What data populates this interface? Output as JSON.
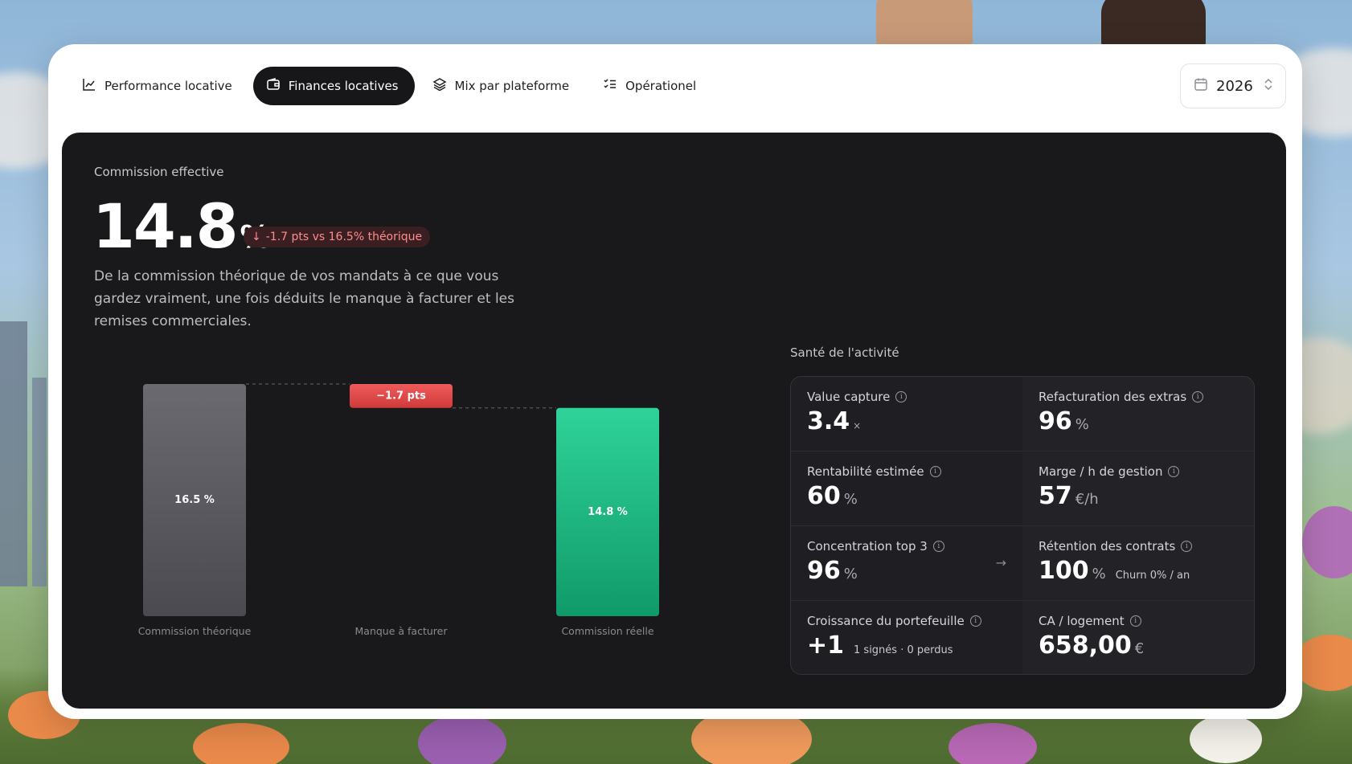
{
  "tabs": [
    {
      "label": "Performance locative",
      "icon": "chart-line-icon",
      "active": false
    },
    {
      "label": "Finances locatives",
      "icon": "wallet-icon",
      "active": true
    },
    {
      "label": "Mix par plateforme",
      "icon": "layers-icon",
      "active": false
    },
    {
      "label": "Opérationel",
      "icon": "checklist-icon",
      "active": false
    }
  ],
  "year_selector": {
    "value": "2026",
    "icon": "calendar-icon"
  },
  "commission": {
    "label": "Commission effective",
    "value": "14.8",
    "unit": "%",
    "delta": "-1.7 pts vs 16.5% théorique",
    "description": "De la commission théorique de vos mandats à ce que vous gardez vraiment, une fois déduits le manque à facturer et les remises commerciales."
  },
  "chart_data": {
    "type": "bar",
    "subtype": "waterfall",
    "categories": [
      "Commission théorique",
      "Manque à facturer",
      "Commission réelle"
    ],
    "values": [
      16.5,
      -1.7,
      14.8
    ],
    "data_labels": [
      "16.5 %",
      "−1.7 pts",
      "14.8 %"
    ],
    "colors": [
      "#5a5a60",
      "#e24b4b",
      "#22c58b"
    ],
    "ylim": [
      0,
      16.5
    ]
  },
  "health": {
    "title": "Santé de l'activité",
    "metrics": [
      {
        "label": "Value capture",
        "value": "3.4",
        "unit": "×",
        "sub": ""
      },
      {
        "label": "Refacturation des extras",
        "value": "96",
        "unit": "%",
        "sub": ""
      },
      {
        "label": "Rentabilité estimée",
        "value": "60",
        "unit": "%",
        "sub": ""
      },
      {
        "label": "Marge / h de gestion",
        "value": "57",
        "unit": "€/h",
        "sub": ""
      },
      {
        "label": "Concentration top 3",
        "value": "96",
        "unit": "%",
        "sub": "",
        "arrow": "→"
      },
      {
        "label": "Rétention des contrats",
        "value": "100",
        "unit": "%",
        "sub": "Churn 0% / an"
      },
      {
        "label": "Croissance du portefeuille",
        "value": "+1",
        "unit": "",
        "sub": "1 signés · 0 perdus"
      },
      {
        "label": "CA / logement",
        "value": "658,00",
        "unit": "€",
        "sub": ""
      }
    ]
  }
}
